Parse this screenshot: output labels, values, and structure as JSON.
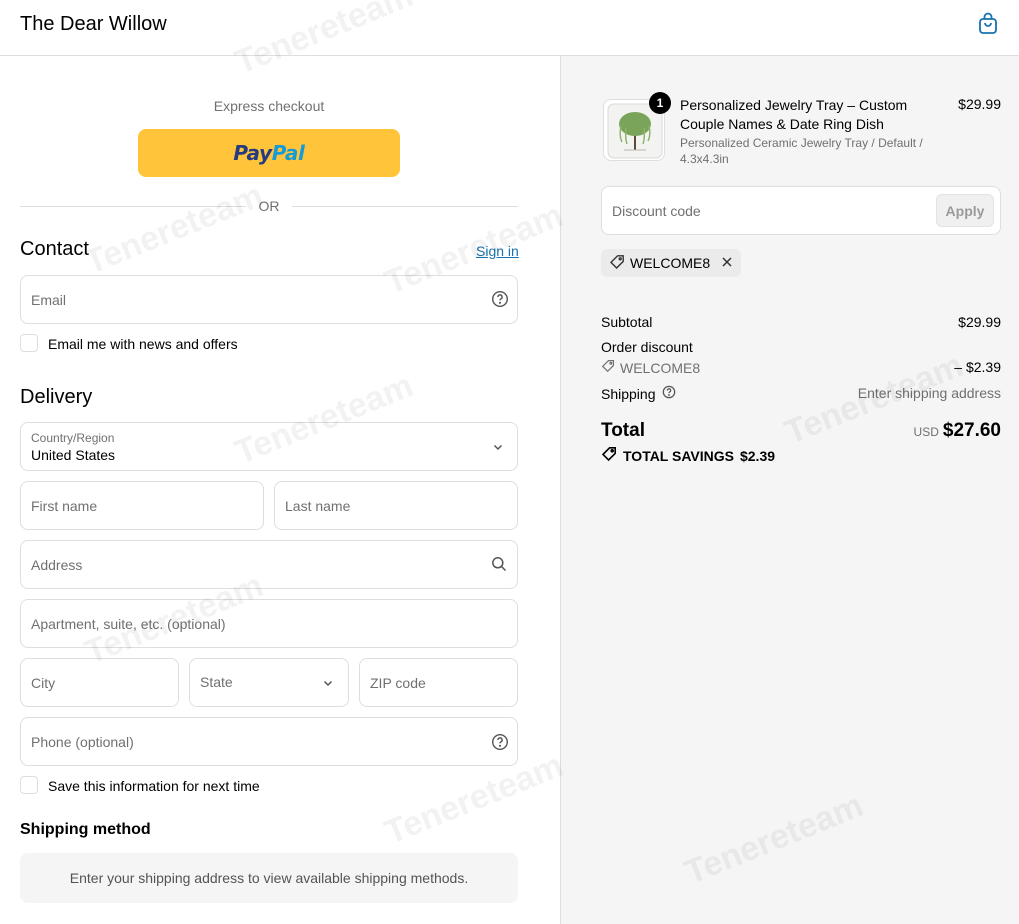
{
  "header": {
    "brand": "The Dear Willow"
  },
  "express": {
    "label": "Express checkout",
    "paypal_a": "Pay",
    "paypal_b": "Pal",
    "or": "OR"
  },
  "contact": {
    "title": "Contact",
    "sign_in": "Sign in",
    "email_placeholder": "Email",
    "news_label": "Email me with news and offers"
  },
  "delivery": {
    "title": "Delivery",
    "country_label": "Country/Region",
    "country_value": "United States",
    "first_name": "First name",
    "last_name": "Last name",
    "address": "Address",
    "apartment": "Apartment, suite, etc. (optional)",
    "city": "City",
    "state": "State",
    "zip": "ZIP code",
    "phone": "Phone (optional)",
    "save_label": "Save this information for next time"
  },
  "shipping": {
    "title": "Shipping method",
    "message": "Enter your shipping address to view available shipping methods."
  },
  "cart": {
    "quantity": "1",
    "product_title": "Personalized Jewelry Tray – Custom Couple Names & Date Ring Dish",
    "product_variant": "Personalized Ceramic Jewelry Tray / Default / 4.3x4.3in",
    "product_price": "$29.99",
    "discount_placeholder": "Discount code",
    "apply_label": "Apply",
    "applied_code": "WELCOME8"
  },
  "summary": {
    "subtotal_label": "Subtotal",
    "subtotal_value": "$29.99",
    "order_discount_label": "Order discount",
    "discount_code": "WELCOME8",
    "discount_value": "– $2.39",
    "shipping_label": "Shipping",
    "shipping_value": "Enter shipping address",
    "total_label": "Total",
    "currency": "USD",
    "total_value": "$27.60",
    "savings_label": "TOTAL SAVINGS",
    "savings_value": "$2.39"
  },
  "watermark": "Tenereteam",
  "colors": {
    "paypal_yellow": "#ffc439",
    "link_blue": "#1773b0",
    "sidebar_bg": "#f5f5f5"
  }
}
